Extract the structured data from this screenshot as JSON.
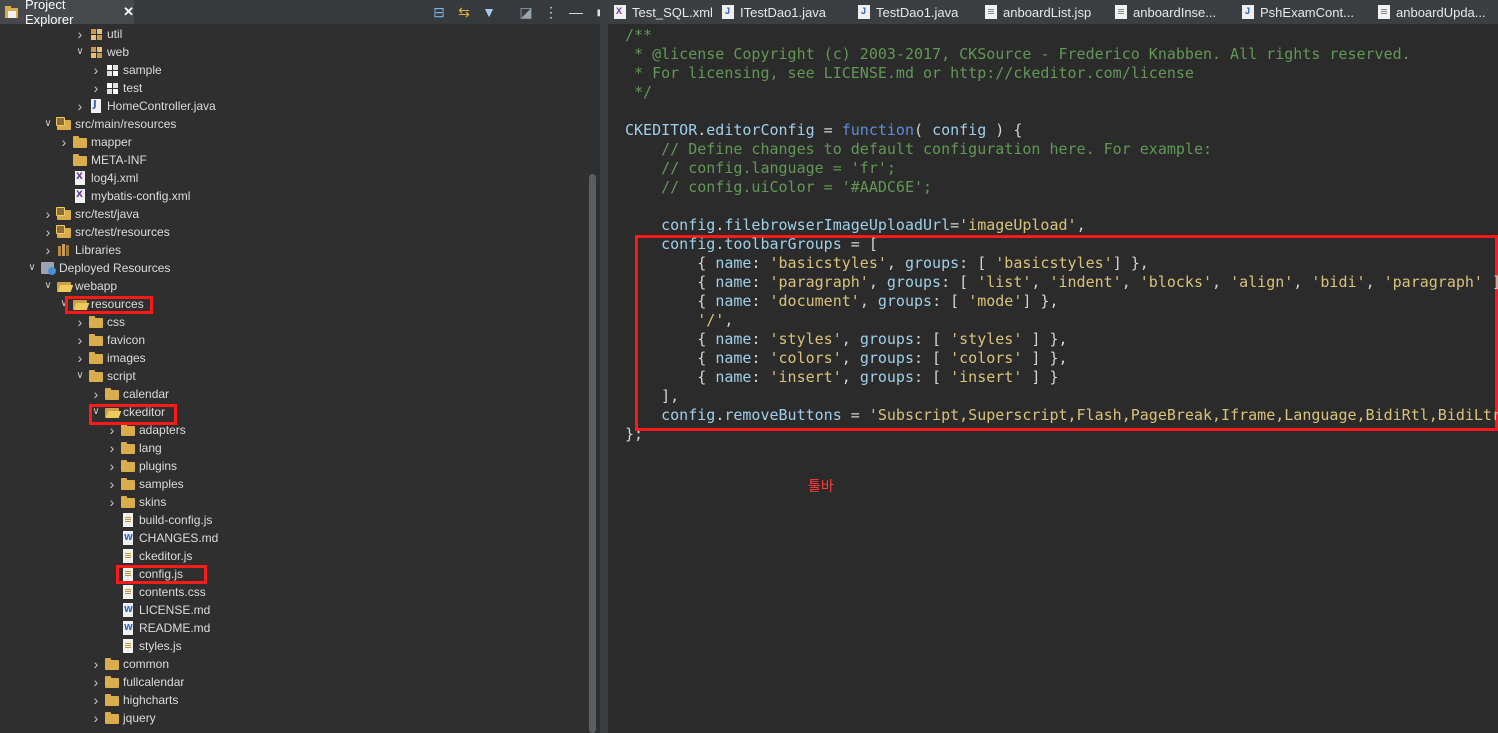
{
  "view": {
    "title": "Project Explorer",
    "close_glyph": "✕",
    "actions": [
      {
        "icon": "collapse-all-icon",
        "glyph": "⊟",
        "color": "#7fb3e0"
      },
      {
        "icon": "link-with-editor-icon",
        "glyph": "⇆",
        "color": "#e0b040"
      },
      {
        "icon": "filter-icon",
        "glyph": "▼",
        "color": "#a9c7ea"
      },
      {
        "icon": "focus-icon",
        "glyph": "◪",
        "color": "#9aa4ae"
      },
      {
        "icon": "view-menu-icon",
        "glyph": "⋮",
        "color": "#e0e0e0"
      },
      {
        "icon": "minimize-icon",
        "glyph": "—",
        "color": "#e0e0e0"
      },
      {
        "icon": "maximize-icon",
        "glyph": "■",
        "color": "#e0e0e0"
      }
    ]
  },
  "tree": {
    "rows": [
      {
        "label": "util",
        "icon": "package-icon",
        "icls": "i-pkg",
        "depth": 3,
        "twisty": "right"
      },
      {
        "label": "web",
        "icon": "package-icon",
        "icls": "i-pkg",
        "depth": 3,
        "twisty": "down"
      },
      {
        "label": "sample",
        "icon": "package-icon",
        "icls": "i-pkgw",
        "depth": 4,
        "twisty": "right"
      },
      {
        "label": "test",
        "icon": "package-icon",
        "icls": "i-pkgw",
        "depth": 4,
        "twisty": "right"
      },
      {
        "label": "HomeController.java",
        "icon": "java-file-icon",
        "icls": "i-java",
        "depth": 3,
        "twisty": "right"
      },
      {
        "label": "src/main/resources",
        "icon": "source-folder-icon",
        "icls": "i-srcfolder",
        "depth": 1,
        "twisty": "down"
      },
      {
        "label": "mapper",
        "icon": "folder-icon",
        "icls": "i-folder",
        "depth": 2,
        "twisty": "right"
      },
      {
        "label": "META-INF",
        "icon": "folder-icon",
        "icls": "i-folder",
        "depth": 2,
        "twisty": ""
      },
      {
        "label": "log4j.xml",
        "icon": "xml-file-icon",
        "icls": "i-xml",
        "depth": 2,
        "twisty": ""
      },
      {
        "label": "mybatis-config.xml",
        "icon": "xml-file-icon",
        "icls": "i-xml",
        "depth": 2,
        "twisty": ""
      },
      {
        "label": "src/test/java",
        "icon": "source-folder-icon",
        "icls": "i-srcfolder",
        "depth": 1,
        "twisty": "right"
      },
      {
        "label": "src/test/resources",
        "icon": "source-folder-icon",
        "icls": "i-srcfolder",
        "depth": 1,
        "twisty": "right"
      },
      {
        "label": "Libraries",
        "icon": "library-icon",
        "icls": "i-lib",
        "depth": 1,
        "twisty": "right"
      },
      {
        "label": "Deployed Resources",
        "icon": "deployed-resources-icon",
        "icls": "i-deployed",
        "depth": 0,
        "twisty": "down"
      },
      {
        "label": "webapp",
        "icon": "folder-open-icon",
        "icls": "i-ofolder",
        "depth": 1,
        "twisty": "down"
      },
      {
        "label": "resources",
        "icon": "folder-open-icon",
        "icls": "i-ofolder",
        "depth": 2,
        "twisty": "down"
      },
      {
        "label": "css",
        "icon": "folder-icon",
        "icls": "i-folder",
        "depth": 3,
        "twisty": "right"
      },
      {
        "label": "favicon",
        "icon": "folder-icon",
        "icls": "i-folder",
        "depth": 3,
        "twisty": "right"
      },
      {
        "label": "images",
        "icon": "folder-icon",
        "icls": "i-folder",
        "depth": 3,
        "twisty": "right"
      },
      {
        "label": "script",
        "icon": "folder-icon",
        "icls": "i-folder",
        "depth": 3,
        "twisty": "down"
      },
      {
        "label": "calendar",
        "icon": "folder-icon",
        "icls": "i-folder",
        "depth": 4,
        "twisty": "right"
      },
      {
        "label": "ckeditor",
        "icon": "folder-open-icon",
        "icls": "i-ofolder",
        "depth": 4,
        "twisty": "down"
      },
      {
        "label": "adapters",
        "icon": "folder-icon",
        "icls": "i-folder",
        "depth": 5,
        "twisty": "right"
      },
      {
        "label": "lang",
        "icon": "folder-icon",
        "icls": "i-folder",
        "depth": 5,
        "twisty": "right"
      },
      {
        "label": "plugins",
        "icon": "folder-icon",
        "icls": "i-folder",
        "depth": 5,
        "twisty": "right"
      },
      {
        "label": "samples",
        "icon": "folder-icon",
        "icls": "i-folder",
        "depth": 5,
        "twisty": "right"
      },
      {
        "label": "skins",
        "icon": "folder-icon",
        "icls": "i-folder",
        "depth": 5,
        "twisty": "right"
      },
      {
        "label": "build-config.js",
        "icon": "js-file-icon",
        "icls": "i-js",
        "depth": 5,
        "twisty": ""
      },
      {
        "label": "CHANGES.md",
        "icon": "md-file-icon",
        "icls": "i-md",
        "depth": 5,
        "twisty": ""
      },
      {
        "label": "ckeditor.js",
        "icon": "js-file-icon",
        "icls": "i-js",
        "depth": 5,
        "twisty": ""
      },
      {
        "label": "config.js",
        "icon": "js-file-icon",
        "icls": "i-js",
        "depth": 5,
        "twisty": ""
      },
      {
        "label": "contents.css",
        "icon": "css-file-icon",
        "icls": "i-js",
        "depth": 5,
        "twisty": ""
      },
      {
        "label": "LICENSE.md",
        "icon": "md-file-icon",
        "icls": "i-md",
        "depth": 5,
        "twisty": ""
      },
      {
        "label": "README.md",
        "icon": "md-file-icon",
        "icls": "i-md",
        "depth": 5,
        "twisty": ""
      },
      {
        "label": "styles.js",
        "icon": "js-file-icon",
        "icls": "i-js",
        "depth": 5,
        "twisty": ""
      },
      {
        "label": "common",
        "icon": "folder-icon",
        "icls": "i-folder",
        "depth": 4,
        "twisty": "right"
      },
      {
        "label": "fullcalendar",
        "icon": "folder-icon",
        "icls": "i-folder",
        "depth": 4,
        "twisty": "right"
      },
      {
        "label": "highcharts",
        "icon": "folder-icon",
        "icls": "i-folder",
        "depth": 4,
        "twisty": "right"
      },
      {
        "label": "jquery",
        "icon": "folder-icon",
        "icls": "i-folder",
        "depth": 4,
        "twisty": "right"
      }
    ]
  },
  "editor": {
    "tabs": [
      {
        "label": "Test_SQL.xml",
        "type": "xml"
      },
      {
        "label": "ITestDao1.java",
        "type": "java"
      },
      {
        "label": "TestDao1.java",
        "type": "java"
      },
      {
        "label": "anboardList.jsp",
        "type": "jsp"
      },
      {
        "label": "anboardInse...",
        "type": "jsp"
      },
      {
        "label": "PshExamCont...",
        "type": "java"
      },
      {
        "label": "anboardUpda...",
        "type": "jsp"
      }
    ],
    "lines": [
      [
        [
          "/**",
          "cm"
        ]
      ],
      [
        [
          " * @license Copyright (c) 2003-2017, CKSource - Frederico Knabben. All rights reserved.",
          "cm"
        ]
      ],
      [
        [
          " * For licensing, see LICENSE.md or http://ckeditor.com/license",
          "cm"
        ]
      ],
      [
        [
          " */",
          "cm"
        ]
      ],
      [],
      [
        [
          "CKEDITOR",
          "idv"
        ],
        [
          ".",
          "pl"
        ],
        [
          "editorConfig",
          "idv"
        ],
        [
          " = ",
          "pl"
        ],
        [
          "function",
          "fn"
        ],
        [
          "( ",
          "pl"
        ],
        [
          "config",
          "idv"
        ],
        [
          " ) {",
          "pl"
        ]
      ],
      [
        [
          "    // Define changes to default configuration here. For example:",
          "cm"
        ]
      ],
      [
        [
          "    // config.language = 'fr';",
          "cm"
        ]
      ],
      [
        [
          "    // config.uiColor = '#AADC6E';",
          "cm"
        ]
      ],
      [],
      [
        [
          "    ",
          "pl"
        ],
        [
          "config",
          "idv"
        ],
        [
          ".",
          "pl"
        ],
        [
          "filebrowserImageUploadUrl",
          "idv"
        ],
        [
          "=",
          "pl"
        ],
        [
          "'imageUpload'",
          "str"
        ],
        [
          ",",
          "pl"
        ]
      ],
      [
        [
          "    ",
          "pl"
        ],
        [
          "config",
          "idv"
        ],
        [
          ".",
          "pl"
        ],
        [
          "toolbarGroups",
          "idv"
        ],
        [
          " = [",
          "pl"
        ]
      ],
      [
        [
          "        { ",
          "pl"
        ],
        [
          "name",
          "idv"
        ],
        [
          ": ",
          "pl"
        ],
        [
          "'basicstyles'",
          "str"
        ],
        [
          ", ",
          "pl"
        ],
        [
          "groups",
          "idv"
        ],
        [
          ": [ ",
          "pl"
        ],
        [
          "'basicstyles'",
          "str"
        ],
        [
          "] },",
          "pl"
        ]
      ],
      [
        [
          "        { ",
          "pl"
        ],
        [
          "name",
          "idv"
        ],
        [
          ": ",
          "pl"
        ],
        [
          "'paragraph'",
          "str"
        ],
        [
          ", ",
          "pl"
        ],
        [
          "groups",
          "idv"
        ],
        [
          ": [ ",
          "pl"
        ],
        [
          "'list'",
          "str"
        ],
        [
          ", ",
          "pl"
        ],
        [
          "'indent'",
          "str"
        ],
        [
          ", ",
          "pl"
        ],
        [
          "'blocks'",
          "str"
        ],
        [
          ", ",
          "pl"
        ],
        [
          "'align'",
          "str"
        ],
        [
          ", ",
          "pl"
        ],
        [
          "'bidi'",
          "str"
        ],
        [
          ", ",
          "pl"
        ],
        [
          "'paragraph'",
          "str"
        ],
        [
          " ] },",
          "pl"
        ]
      ],
      [
        [
          "        { ",
          "pl"
        ],
        [
          "name",
          "idv"
        ],
        [
          ": ",
          "pl"
        ],
        [
          "'document'",
          "str"
        ],
        [
          ", ",
          "pl"
        ],
        [
          "groups",
          "idv"
        ],
        [
          ": [ ",
          "pl"
        ],
        [
          "'mode'",
          "str"
        ],
        [
          "] },",
          "pl"
        ]
      ],
      [
        [
          "        ",
          "pl"
        ],
        [
          "'/'",
          "str"
        ],
        [
          ",",
          "pl"
        ]
      ],
      [
        [
          "        { ",
          "pl"
        ],
        [
          "name",
          "idv"
        ],
        [
          ": ",
          "pl"
        ],
        [
          "'styles'",
          "str"
        ],
        [
          ", ",
          "pl"
        ],
        [
          "groups",
          "idv"
        ],
        [
          ": [ ",
          "pl"
        ],
        [
          "'styles'",
          "str"
        ],
        [
          " ] },",
          "pl"
        ]
      ],
      [
        [
          "        { ",
          "pl"
        ],
        [
          "name",
          "idv"
        ],
        [
          ": ",
          "pl"
        ],
        [
          "'colors'",
          "str"
        ],
        [
          ", ",
          "pl"
        ],
        [
          "groups",
          "idv"
        ],
        [
          ": [ ",
          "pl"
        ],
        [
          "'colors'",
          "str"
        ],
        [
          " ] },",
          "pl"
        ]
      ],
      [
        [
          "        { ",
          "pl"
        ],
        [
          "name",
          "idv"
        ],
        [
          ": ",
          "pl"
        ],
        [
          "'insert'",
          "str"
        ],
        [
          ", ",
          "pl"
        ],
        [
          "groups",
          "idv"
        ],
        [
          ": [ ",
          "pl"
        ],
        [
          "'insert'",
          "str"
        ],
        [
          " ] }",
          "pl"
        ]
      ],
      [
        [
          "    ],",
          "pl"
        ]
      ],
      [
        [
          "    ",
          "pl"
        ],
        [
          "config",
          "idv"
        ],
        [
          ".",
          "pl"
        ],
        [
          "removeButtons",
          "idv"
        ],
        [
          " = ",
          "pl"
        ],
        [
          "'Subscript,Superscript,Flash,PageBreak,Iframe,Language,BidiRtl,BidiLtr'",
          "str"
        ],
        [
          ";",
          "pl"
        ]
      ],
      [
        [
          "};",
          "pl"
        ]
      ]
    ],
    "annotation": "툴바"
  },
  "colors": {
    "highlight_border": "#ff1a1a",
    "comment": "#629755",
    "string": "#d8c27a",
    "keyword": "#5f8ddc",
    "identifier": "#9fcfe8"
  }
}
